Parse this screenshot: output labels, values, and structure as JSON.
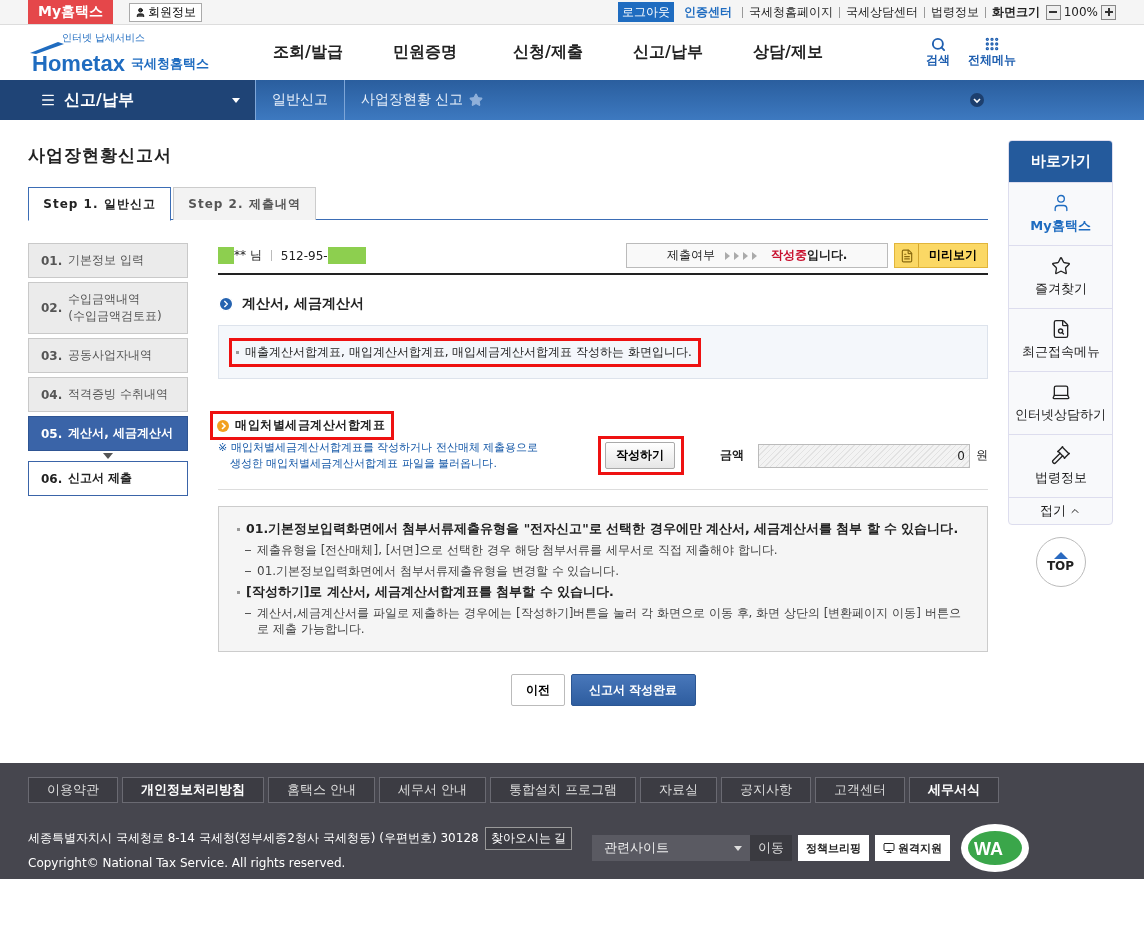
{
  "top_bar": {
    "my_hometax": "My홈택스",
    "member_info": "회원정보",
    "logout": "로그아웃",
    "cert_center": "인증센터",
    "links": [
      "국세청홈페이지",
      "국세상담센터",
      "법령정보"
    ],
    "zoom_label": "화면크기",
    "zoom_value": "100%"
  },
  "header": {
    "logo_tagline": "인터넷 납세서비스",
    "logo_text": "Hometax",
    "logo_subtitle": "국세청홈택스",
    "menu": [
      "조회/발급",
      "민원증명",
      "신청/제출",
      "신고/납부",
      "상담/제보"
    ],
    "search": "검색",
    "all_menu": "전체메뉴"
  },
  "breadcrumb": {
    "section": "신고/납부",
    "items": [
      "일반신고",
      "사업장현황 신고"
    ]
  },
  "page_title": "사업장현황신고서",
  "tabs": [
    {
      "label": "Step 1. 일반신고",
      "selected": true
    },
    {
      "label": "Step 2. 제출내역",
      "selected": false
    }
  ],
  "steps": [
    {
      "number": "01.",
      "lines": [
        "기본정보 입력"
      ],
      "completed": true,
      "selected": false
    },
    {
      "number": "02.",
      "lines": [
        "수입금액내역",
        "(수입금액검토표)"
      ],
      "completed": true,
      "selected": false
    },
    {
      "number": "03.",
      "lines": [
        "공동사업자내역"
      ],
      "completed": true,
      "selected": false
    },
    {
      "number": "04.",
      "lines": [
        "적격증빙 수취내역"
      ],
      "completed": true,
      "selected": false
    },
    {
      "number": "05.",
      "lines": [
        "계산서, 세금계산서"
      ],
      "completed": false,
      "selected": true
    },
    {
      "number": "06.",
      "lines": [
        "신고서 제출"
      ],
      "completed": false,
      "selected": false
    }
  ],
  "taxpayer": {
    "name": "** 님",
    "id": "512-95-"
  },
  "status_box": {
    "label": "제출여부",
    "value": "작성중",
    "suffix": "입니다."
  },
  "preview_button": "미리보기",
  "section_title": "계산서, 세금계산서",
  "notice": {
    "text": "매출계산서합계표, 매입계산서합계표, 매입세금계산서합계표 작성하는 화면입니다.",
    "highlighted": true
  },
  "subsection": {
    "title": "매입처별세금계산서합계표",
    "highlighted": true,
    "description": [
      "※ 매입처별세금계산서합계표를 작성하거나 전산매체 제출용으로",
      "생성한 매입처별세금계산서합계표 파일을 불러옵니다."
    ],
    "write_button": {
      "label": "작성하기",
      "highlighted": true
    },
    "amount_label": "금액",
    "amount_value": "0",
    "unit": "원"
  },
  "info": [
    {
      "kind": "bullet",
      "text": "01.기본정보입력화면에서 첨부서류제출유형을 \"전자신고\"로 선택한 경우에만 계산서, 세금계산서를 첨부 할 수 있습니다."
    },
    {
      "kind": "dash",
      "text": "제출유형을 [전산매체], [서면]으로 선택한 경우 해당 첨부서류를 세무서로 직접 제출해야 합니다."
    },
    {
      "kind": "dash",
      "text": "01.기본정보입력화면에서 첨부서류제출유형을 변경할 수 있습니다."
    },
    {
      "kind": "bullet",
      "text": "[작성하기]로 계산서, 세금계산서합계표를 첨부할 수 있습니다."
    },
    {
      "kind": "dash",
      "text": "계산서,세금계산서를 파일로 제출하는 경우에는 [작성하기]버튼을 눌러 각 화면으로 이동 후, 화면 상단의 [변환페이지 이동] 버튼으로 제출 가능합니다."
    }
  ],
  "buttons": {
    "prev": "이전",
    "complete": "신고서 작성완료"
  },
  "quick_menu": {
    "title": "바로가기",
    "items": [
      {
        "label": "My홈택스",
        "kind": "my"
      },
      {
        "label": "즐겨찾기",
        "kind": "favorite"
      },
      {
        "label": "최근접속메뉴",
        "kind": "recent"
      },
      {
        "label": "인터넷상담하기",
        "kind": "consult"
      },
      {
        "label": "법령정보",
        "kind": "law"
      }
    ],
    "collapse": "접기",
    "top": "TOP"
  },
  "footer": {
    "links": [
      {
        "label": "이용약관",
        "emphasis": false
      },
      {
        "label": "개인정보처리방침",
        "emphasis": true
      },
      {
        "label": "홈택스 안내",
        "emphasis": false
      },
      {
        "label": "세무서 안내",
        "emphasis": false
      },
      {
        "label": "통합설치 프로그램",
        "emphasis": false
      },
      {
        "label": "자료실",
        "emphasis": false
      },
      {
        "label": "공지사항",
        "emphasis": false
      },
      {
        "label": "고객센터",
        "emphasis": false
      },
      {
        "label": "세무서식",
        "emphasis": true
      }
    ],
    "address": "세종특별자치시 국세청로 8-14 국세청(정부세종2청사 국세청동) (우편번호) 30128",
    "directions": "찾아오시는 길",
    "copyright": "Copyright© National Tax Service. All rights reserved.",
    "related_select": "관련사이트",
    "go": "이동",
    "policy_badge": "정책브리핑",
    "remote_badge": "원격지원",
    "wa_mark": "WA"
  }
}
